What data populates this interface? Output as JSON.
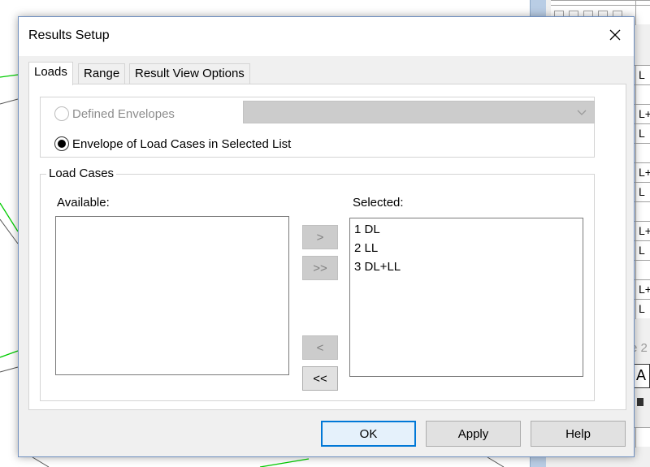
{
  "dialog": {
    "title": "Results Setup",
    "tabs": [
      {
        "label": "Loads"
      },
      {
        "label": "Range"
      },
      {
        "label": "Result View Options"
      }
    ],
    "envelope": {
      "defined_label": "Defined Envelopes",
      "defined_selected_value": "",
      "selected_list_label": "Envelope of Load Cases in Selected List"
    },
    "load_cases": {
      "group_label": "Load Cases",
      "available_label": "Available:",
      "selected_label": "Selected:",
      "available_items": [],
      "selected_items": [
        "1 DL",
        "2 LL",
        "3 DL+LL"
      ]
    },
    "move_buttons": {
      "add": ">",
      "add_all": ">>",
      "remove": "<",
      "remove_all": "<<"
    },
    "buttons": {
      "ok": "OK",
      "apply": "Apply",
      "help": "Help"
    }
  },
  "background": {
    "grid_cells": [
      "L",
      "",
      "L+",
      "L",
      "",
      "L+",
      "L",
      "",
      "L+",
      "L",
      "",
      "L+",
      "L"
    ],
    "partial_text": "e 2",
    "partial_button": "A",
    "colors": {
      "accent": "#0078d7",
      "dialog_bg": "#f0f0f0",
      "panel_blue": "#b9cde5",
      "line_green": "#00cc00"
    }
  }
}
